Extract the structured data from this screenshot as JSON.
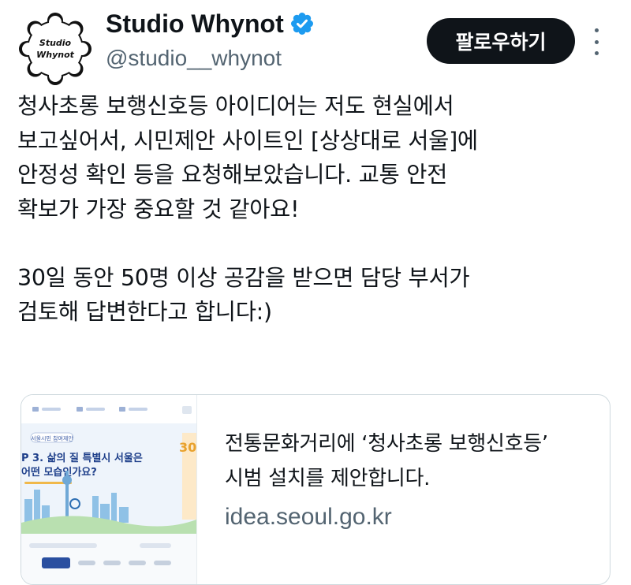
{
  "profile": {
    "avatar_text_line1": "Studio",
    "avatar_text_line2": "Whynot",
    "display_name": "Studio Whynot",
    "handle": "@studio__whynot"
  },
  "actions": {
    "follow_label": "팔로우하기"
  },
  "tweet": {
    "lines": [
      "청사초롱 보행신호등 아이디어는 저도 현실에서",
      "보고싶어서, 시민제안 사이트인 [상상대로 서울]에",
      "안정성 확인 등을 요청해보았습니다. 교통 안전",
      "확보가 가장 중요할 것 같아요!",
      "",
      "30일 동안 50명 이상 공감을 받으면 담당 부서가",
      "검토해 답변한다고 합니다:)"
    ]
  },
  "link_card": {
    "title_line1": "전통문화거리에 ‘청사초롱 보행신호등’",
    "title_line2": "시범 설치를 제안합니다.",
    "domain": "idea.seoul.go.kr",
    "thumbnail": {
      "badge": "서울시민 참여제안",
      "headline_line1": "P 3. 삶의 질 특별시 서울은",
      "headline_line2": "어떤 모습인가요?",
      "big_number": "30"
    }
  },
  "colors": {
    "text": "#0f1419",
    "secondary": "#536471",
    "verified": "#1d9bf0",
    "button_bg": "#0f1419",
    "card_border": "#cfd9de"
  },
  "icons": {
    "verified": "verified-badge-icon",
    "more": "more-options-icon"
  }
}
